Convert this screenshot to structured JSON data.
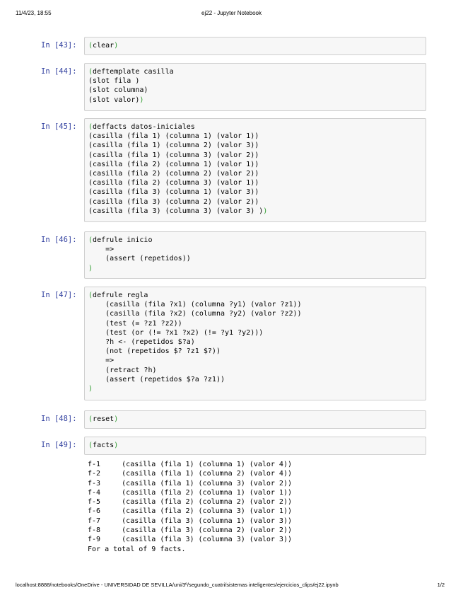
{
  "header": {
    "datetime": "11/4/23, 18:55",
    "title": "ej22 - Jupyter Notebook"
  },
  "cells": [
    {
      "prompt": "In [43]:",
      "lines": [
        "(clear)"
      ]
    },
    {
      "prompt": "In [44]:",
      "lines": [
        "(deftemplate casilla",
        "(slot fila )",
        "(slot columna)",
        "(slot valor))"
      ]
    },
    {
      "prompt": "In [45]:",
      "lines": [
        "(deffacts datos-iniciales",
        "(casilla (fila 1) (columna 1) (valor 1))",
        "(casilla (fila 1) (columna 2) (valor 3))",
        "(casilla (fila 1) (columna 3) (valor 2))",
        "(casilla (fila 2) (columna 1) (valor 1))",
        "(casilla (fila 2) (columna 2) (valor 2))",
        "(casilla (fila 2) (columna 3) (valor 1))",
        "(casilla (fila 3) (columna 1) (valor 3))",
        "(casilla (fila 3) (columna 2) (valor 2))",
        "(casilla (fila 3) (columna 3) (valor 3) ))"
      ]
    },
    {
      "prompt": "In [46]:",
      "lines": [
        "(defrule inicio",
        "    =>",
        "    (assert (repetidos))",
        ")"
      ]
    },
    {
      "prompt": "In [47]:",
      "lines": [
        "(defrule regla",
        "    (casilla (fila ?x1) (columna ?y1) (valor ?z1))",
        "    (casilla (fila ?x2) (columna ?y2) (valor ?z2))",
        "    (test (= ?z1 ?z2))",
        "    (test (or (!= ?x1 ?x2) (!= ?y1 ?y2)))",
        "    ?h <- (repetidos $?a)",
        "    (not (repetidos $? ?z1 $?))",
        "    =>",
        "    (retract ?h)",
        "    (assert (repetidos $?a ?z1))",
        ")"
      ]
    },
    {
      "prompt": "In [48]:",
      "lines": [
        "(reset)"
      ]
    },
    {
      "prompt": "In [49]:",
      "lines": [
        "(facts)"
      ]
    }
  ],
  "output": {
    "lines": [
      "f-1     (casilla (fila 1) (columna 1) (valor 4))",
      "f-2     (casilla (fila 1) (columna 2) (valor 4))",
      "f-3     (casilla (fila 1) (columna 3) (valor 2))",
      "f-4     (casilla (fila 2) (columna 1) (valor 1))",
      "f-5     (casilla (fila 2) (columna 2) (valor 2))",
      "f-6     (casilla (fila 2) (columna 3) (valor 1))",
      "f-7     (casilla (fila 3) (columna 1) (valor 3))",
      "f-8     (casilla (fila 3) (columna 2) (valor 2))",
      "f-9     (casilla (fila 3) (columna 3) (valor 3))",
      "For a total of 9 facts."
    ]
  },
  "footer": {
    "url": "localhost:8888/notebooks/OneDrive - UNIVERSIDAD DE SEVILLA/uni/3º/segundo_cuatri/sistemas inteligentes/ejercicios_clips/ej22.ipynb",
    "page": "1/2"
  },
  "colors": {
    "prompt": "#303f9f",
    "paren": "#2e9b2e",
    "cell_bg": "#f7f7f7",
    "cell_border": "#cfcfcf"
  }
}
